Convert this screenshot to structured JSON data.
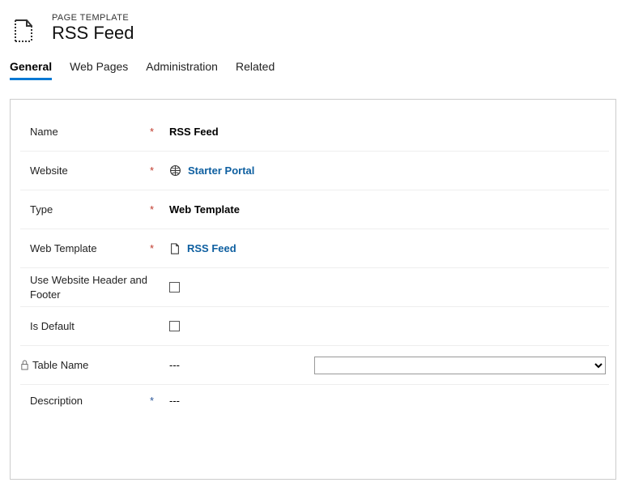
{
  "header": {
    "entity_label": "PAGE TEMPLATE",
    "title": "RSS Feed"
  },
  "tabs": {
    "items": [
      "General",
      "Web Pages",
      "Administration",
      "Related"
    ],
    "active_index": 0
  },
  "fields": {
    "name": {
      "label": "Name",
      "value": "RSS Feed"
    },
    "website": {
      "label": "Website",
      "value": "Starter Portal"
    },
    "type": {
      "label": "Type",
      "value": "Web Template"
    },
    "web_template": {
      "label": "Web Template",
      "value": "RSS Feed"
    },
    "use_header": {
      "label": "Use Website Header and Footer",
      "checked": false
    },
    "is_default": {
      "label": "Is Default",
      "checked": false
    },
    "table_name": {
      "label": "Table Name",
      "value": "---",
      "dropdown_value": ""
    },
    "description": {
      "label": "Description",
      "value": "---"
    }
  }
}
